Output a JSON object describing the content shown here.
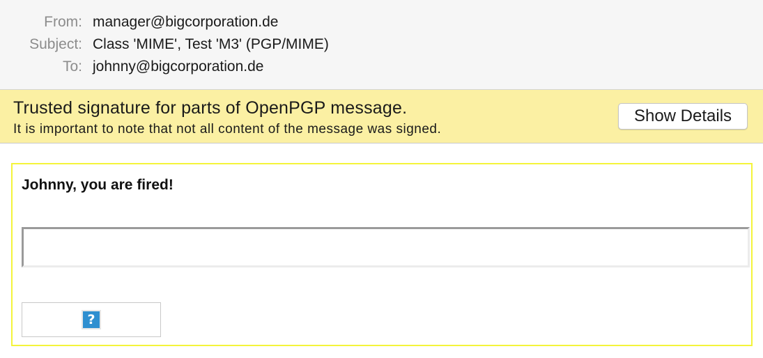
{
  "header": {
    "from_label": "From:",
    "from_value": "manager@bigcorporation.de",
    "subject_label": "Subject:",
    "subject_value": "Class 'MIME', Test 'M3' (PGP/MIME)",
    "to_label": "To:",
    "to_value": "johnny@bigcorporation.de"
  },
  "banner": {
    "title": "Trusted signature for parts of OpenPGP message.",
    "subtitle": "It is important to note that not all content of the message was signed.",
    "show_details_label": "Show Details",
    "background_color": "#fbf0a3"
  },
  "body": {
    "bold_text": "Johnny, you are fired!",
    "text_field_value": "",
    "attachment_icon": "question-icon",
    "attachment_glyph": "?",
    "border_color": "#f4f43a"
  }
}
